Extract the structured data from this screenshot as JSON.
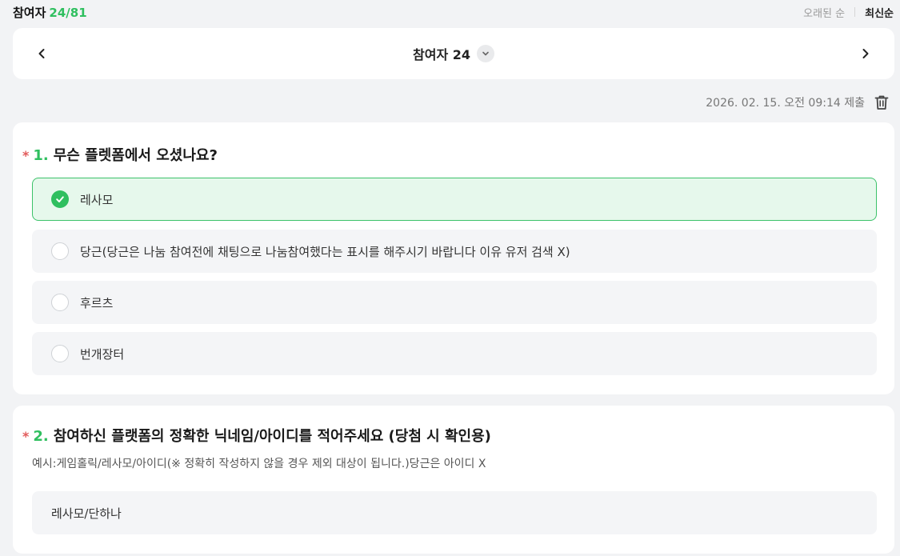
{
  "header": {
    "participants_label": "참여자",
    "participants_count": "24/81",
    "sort_oldest": "오래된 순",
    "sort_newest": "최신순"
  },
  "navigator": {
    "title": "참여자 24",
    "prev_icon": "chevron-left-icon",
    "next_icon": "chevron-right-icon",
    "dropdown_icon": "chevron-down-icon"
  },
  "submission": {
    "submitted_at": "2026. 02. 15. 오전 09:14 제출",
    "delete_icon": "trash-icon"
  },
  "questions": [
    {
      "required_mark": "*",
      "number": "1.",
      "title": "무슨 플렛폼에서 오셨나요?",
      "options": [
        {
          "label": "레사모",
          "selected": true
        },
        {
          "label": "당근(당근은 나눔 참여전에 채팅으로 나눔참여했다는 표시를 해주시기 바랍니다 이유 유저 검색 X)",
          "selected": false
        },
        {
          "label": "후르츠",
          "selected": false
        },
        {
          "label": "번개장터",
          "selected": false
        }
      ]
    },
    {
      "required_mark": "*",
      "number": "2.",
      "title": "참여하신 플랫폼의 정확한 닉네임/아이디를 적어주세요 (당첨 시 확인용)",
      "description": "예시:게임홀릭/레사모/아이디(※ 정확히 작성하지 않을 경우 제외 대상이 됩니다.)당근은 아이디 X",
      "answer": "레사모/단하나"
    }
  ],
  "colors": {
    "accent_green": "#2fbf5f",
    "required_red": "#e25b5b",
    "background": "#f2f3f5"
  }
}
